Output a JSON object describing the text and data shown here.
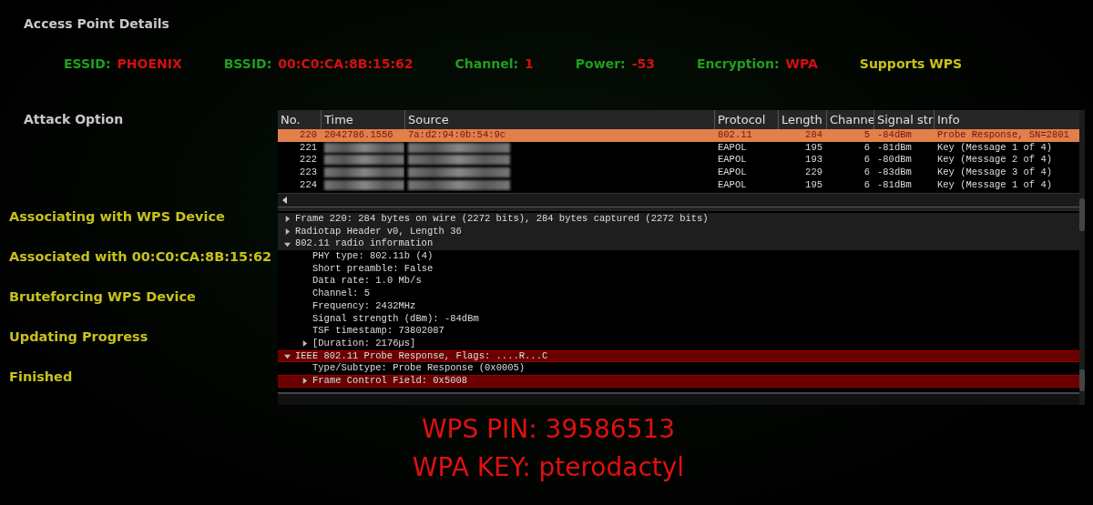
{
  "access_point": {
    "title": "Access Point Details",
    "fields": [
      {
        "label": "ESSID:",
        "value": "PHOENIX"
      },
      {
        "label": "BSSID:",
        "value": "00:C0:CA:8B:15:62"
      },
      {
        "label": "Channel:",
        "value": "1"
      },
      {
        "label": "Power:",
        "value": "-53"
      },
      {
        "label": "Encryption:",
        "value": "WPA"
      }
    ],
    "badge": "Supports WPS"
  },
  "attack": {
    "title": "Attack Option",
    "steps": [
      "Associating with WPS Device",
      "Associated with 00:C0:CA:8B:15:62",
      "Bruteforcing WPS Device",
      "Updating Progress",
      "Finished"
    ]
  },
  "packets": {
    "columns": [
      "No.",
      "Time",
      "Source",
      "Protocol",
      "Length",
      "Channe",
      "Signal str",
      "Info"
    ],
    "rows": [
      {
        "no": "220",
        "time": "2042786.1556",
        "source": "7a:d2:94:0b:54:9c",
        "protocol": "802.11",
        "length": "284",
        "channel": "5",
        "signal": "-84dBm",
        "info": "Probe Response, SN=2801",
        "selected": true,
        "redacted": false
      },
      {
        "no": "221",
        "protocol": "EAPOL",
        "length": "195",
        "channel": "6",
        "signal": "-81dBm",
        "info": "Key (Message 1 of 4)",
        "selected": false,
        "redacted": true
      },
      {
        "no": "222",
        "protocol": "EAPOL",
        "length": "193",
        "channel": "6",
        "signal": "-80dBm",
        "info": "Key (Message 2 of 4)",
        "selected": false,
        "redacted": true
      },
      {
        "no": "223",
        "protocol": "EAPOL",
        "length": "229",
        "channel": "6",
        "signal": "-83dBm",
        "info": "Key (Message 3 of 4)",
        "selected": false,
        "redacted": true
      },
      {
        "no": "224",
        "protocol": "EAPOL",
        "length": "195",
        "channel": "6",
        "signal": "-81dBm",
        "info": "Key (Message 1 of 4)",
        "selected": false,
        "redacted": true
      }
    ]
  },
  "details": [
    {
      "kind": "branch",
      "text": "Frame 220: 284 bytes on wire (2272 bits), 284 bytes captured (2272 bits)",
      "expanded": false,
      "highlighted": false
    },
    {
      "kind": "branch",
      "text": "Radiotap Header v0, Length 36",
      "expanded": false,
      "highlighted": false
    },
    {
      "kind": "branch",
      "text": "802.11 radio information",
      "expanded": true,
      "highlighted": false,
      "children": [
        {
          "kind": "leaf",
          "text": "PHY type: 802.11b (4)",
          "highlighted": false
        },
        {
          "kind": "leaf",
          "text": "Short preamble: False",
          "highlighted": false
        },
        {
          "kind": "leaf",
          "text": "Data rate: 1.0 Mb/s",
          "highlighted": false
        },
        {
          "kind": "leaf",
          "text": "Channel: 5",
          "highlighted": false
        },
        {
          "kind": "leaf",
          "text": "Frequency: 2432MHz",
          "highlighted": false
        },
        {
          "kind": "leaf",
          "text": "Signal strength (dBm): -84dBm",
          "highlighted": false
        },
        {
          "kind": "leaf",
          "text": "TSF timestamp: 73802087",
          "highlighted": false
        },
        {
          "kind": "branch",
          "text": "[Duration: 2176µs]",
          "expanded": false,
          "highlighted": false
        }
      ]
    },
    {
      "kind": "branch",
      "text": "IEEE 802.11 Probe Response, Flags: ....R...C",
      "expanded": true,
      "highlighted": true,
      "children": [
        {
          "kind": "leaf",
          "text": "Type/Subtype: Probe Response (0x0005)",
          "highlighted": false
        },
        {
          "kind": "branch",
          "text": "Frame Control Field: 0x5008",
          "expanded": false,
          "highlighted": true
        }
      ]
    }
  ],
  "result": {
    "pin": "WPS PIN: 39586513",
    "key": "WPA KEY: pterodactyl"
  }
}
